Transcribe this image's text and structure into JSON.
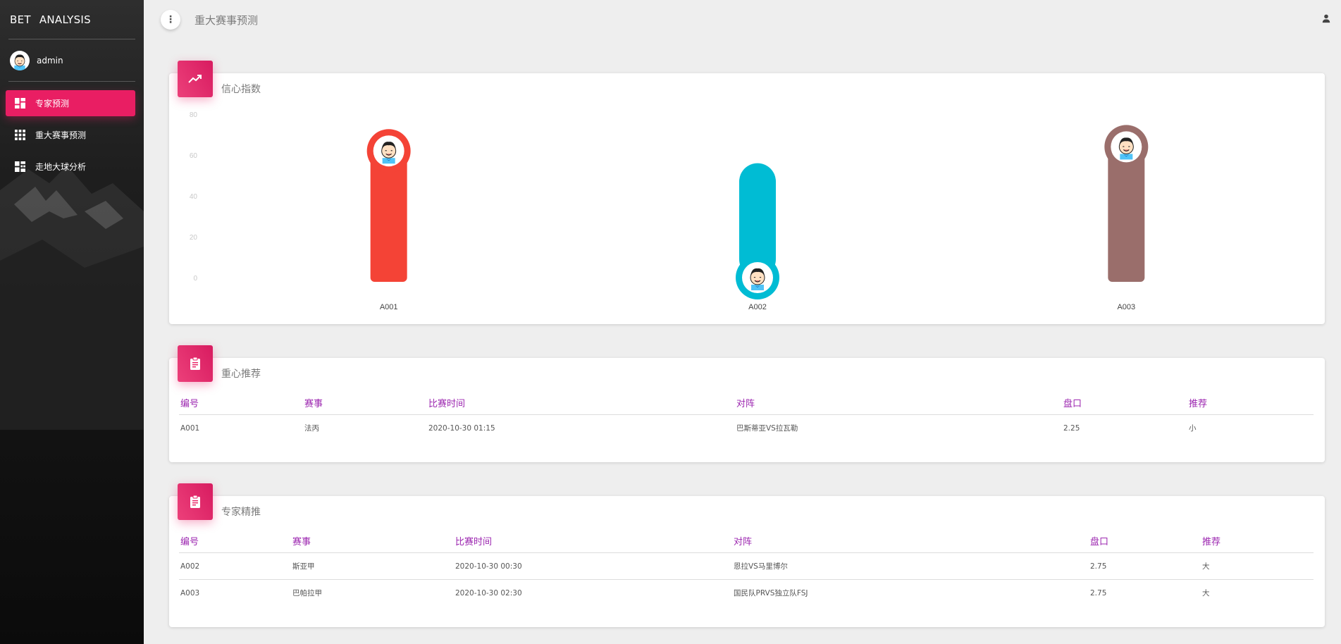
{
  "brand": {
    "part1": "BET",
    "part2": "ANALYSIS"
  },
  "user": {
    "name": "admin"
  },
  "sidebar": {
    "items": [
      {
        "label": "专家预测",
        "icon": "dashboard-icon",
        "active": true
      },
      {
        "label": "重大赛事预测",
        "icon": "apps-grid-icon",
        "active": false
      },
      {
        "label": "走地大球分析",
        "icon": "quilt-icon",
        "active": false
      }
    ]
  },
  "header": {
    "title": "重大赛事预测",
    "menu_glyph": "⋮",
    "account_icon": "person-icon"
  },
  "confidence_card": {
    "title": "信心指数",
    "icon": "trending-up-icon"
  },
  "chart_data": {
    "type": "bar",
    "title": "信心指数",
    "categories": [
      "A001",
      "A002",
      "A003"
    ],
    "values": [
      62,
      0,
      64
    ],
    "colors": [
      "#f44336",
      "#00bcd4",
      "#9a6e6b"
    ],
    "ylim": [
      0,
      80
    ],
    "yticks": [
      0,
      20,
      40,
      60,
      80
    ],
    "grid": false,
    "avatar_on_bar": true
  },
  "key_card": {
    "title": "重心推荐",
    "icon": "clipboard-icon",
    "columns": [
      "编号",
      "赛事",
      "比赛时间",
      "对阵",
      "盘口",
      "推荐"
    ],
    "rows": [
      [
        "A001",
        "法丙",
        "2020-10-30 01:15",
        "巴斯蒂亚VS拉瓦勒",
        "2.25",
        "小"
      ]
    ]
  },
  "expert_card": {
    "title": "专家精推",
    "icon": "clipboard-icon",
    "columns": [
      "编号",
      "赛事",
      "比赛时间",
      "对阵",
      "盘口",
      "推荐"
    ],
    "rows": [
      [
        "A002",
        "斯亚甲",
        "2020-10-30 00:30",
        "恩拉VS马里博尔",
        "2.75",
        "大"
      ],
      [
        "A003",
        "巴帕拉甲",
        "2020-10-30 02:30",
        "国民队PRVS独立队FSJ",
        "2.75",
        "大"
      ]
    ]
  }
}
